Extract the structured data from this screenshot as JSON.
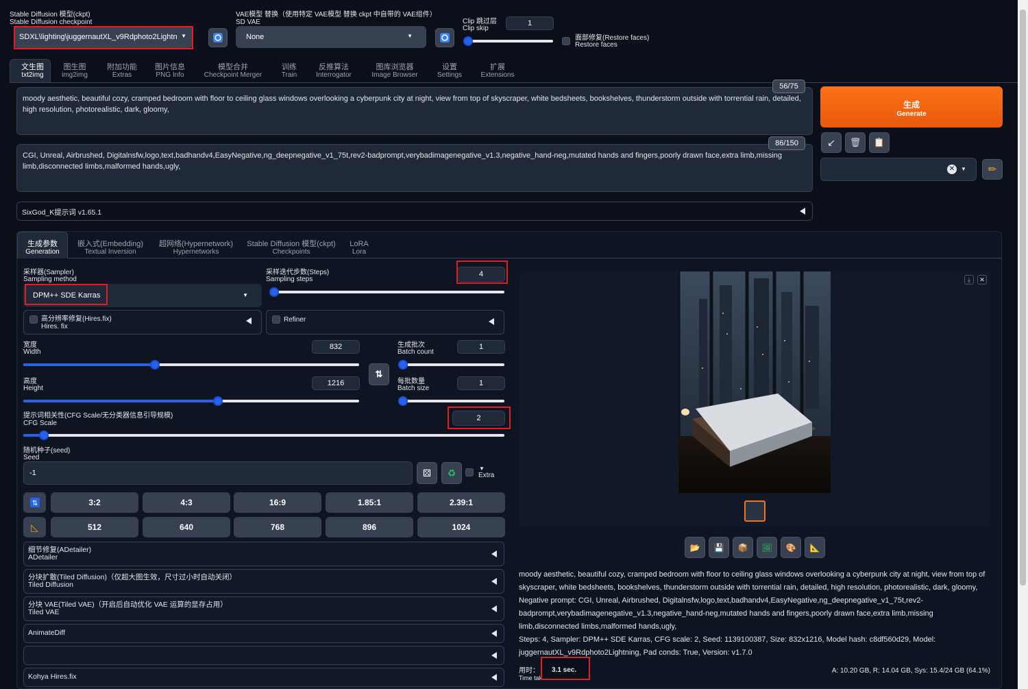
{
  "checkpoint": {
    "label_cn": "Stable Diffusion 模型(ckpt)",
    "label_en": "Stable Diffusion checkpoint",
    "value": "SDXL\\lighting\\juggernautXL_v9Rdphoto2Lightn"
  },
  "vae": {
    "label_cn": "VAE模型 替换（使用特定 VAE模型 替换 ckpt 中自带的 VAE组件）",
    "label_en": "SD VAE",
    "value": "None"
  },
  "clip_skip": {
    "label_cn": "Clip 跳过层",
    "label_en": "Clip skip",
    "value": "1",
    "level": 0.0
  },
  "restore_faces": {
    "label_cn": "面部修复(Restore faces)",
    "label_en": "Restore faces"
  },
  "tabs": [
    {
      "cn": "文生图",
      "en": "txt2img"
    },
    {
      "cn": "图生图",
      "en": "img2img"
    },
    {
      "cn": "附加功能",
      "en": "Extras"
    },
    {
      "cn": "图片信息",
      "en": "PNG Info"
    },
    {
      "cn": "模型合并",
      "en": "Checkpoint Merger"
    },
    {
      "cn": "训练",
      "en": "Train"
    },
    {
      "cn": "反推算法",
      "en": "Interrogator"
    },
    {
      "cn": "图库浏览器",
      "en": "Image Browser"
    },
    {
      "cn": "设置",
      "en": "Settings"
    },
    {
      "cn": "扩展",
      "en": "Extensions"
    }
  ],
  "prompt": {
    "text": "moody aesthetic, beautiful cozy, cramped bedroom with floor to ceiling glass windows overlooking a cyberpunk city at night, view from top of skyscraper, white bedsheets, bookshelves, thunderstorm outside with torrential rain, detailed, high resolution, photorealistic, dark, gloomy,",
    "count": "56/75"
  },
  "negative": {
    "text": "CGI, Unreal, Airbrushed, Digitalnsfw,logo,text,badhandv4,EasyNegative,ng_deepnegative_v1_75t,rev2-badprompt,verybadimagenegative_v1.3,negative_hand-neg,mutated hands and fingers,poorly drawn face,extra limb,missing limb,disconnected limbs,malformed hands,ugly,",
    "count": "86/150"
  },
  "generate": {
    "cn": "生成",
    "en": "Generate"
  },
  "sixgod": "SixGod_K提示词 v1.65.1",
  "subtabs": [
    {
      "cn": "生成参数",
      "en": "Generation"
    },
    {
      "cn": "嵌入式(Embedding)",
      "en": "Textual Inversion"
    },
    {
      "cn": "超网络(Hypernetwork)",
      "en": "Hypernetworks"
    },
    {
      "cn": "Stable Diffusion 模型(ckpt)",
      "en": "Checkpoints"
    },
    {
      "cn": "LoRA",
      "en": "Lora"
    }
  ],
  "sampler": {
    "label_cn": "采样器(Sampler)",
    "label_en": "Sampling method",
    "value": "DPM++ SDE Karras"
  },
  "steps": {
    "label_cn": "采样迭代步数(Steps)",
    "label_en": "Sampling steps",
    "value": "4",
    "level": 0.02
  },
  "hires": {
    "cn": "高分辨率修复(Hires.fix)",
    "en": "Hires. fix"
  },
  "refiner": "Refiner",
  "width": {
    "cn": "宽度",
    "en": "Width",
    "value": "832",
    "level": 0.39
  },
  "height": {
    "cn": "高度",
    "en": "Height",
    "value": "1216",
    "level": 0.58
  },
  "batch_count": {
    "cn": "生成批次",
    "en": "Batch count",
    "value": "1",
    "level": 0.0
  },
  "batch_size": {
    "cn": "每批数量",
    "en": "Batch size",
    "value": "1",
    "level": 0.0
  },
  "cfg": {
    "label_cn": "提示词相关性(CFG Scale/无分类器信息引导规模)",
    "label_en": "CFG Scale",
    "value": "2",
    "level": 0.04
  },
  "seed": {
    "label_cn": "随机种子(seed)",
    "label_en": "Seed",
    "value": "-1",
    "extra": "Extra"
  },
  "aspects": [
    "3:2",
    "4:3",
    "16:9",
    "1.85:1",
    "2.39:1"
  ],
  "sizes": [
    "512",
    "640",
    "768",
    "896",
    "1024"
  ],
  "accordions": [
    {
      "cn": "细节修复(ADetailer)",
      "en": "ADetailer"
    },
    {
      "cn": "分块扩散(Tiled Diffusion)（仅超大图生效，尺寸过小时自动关闭）",
      "en": "Tiled Diffusion"
    },
    {
      "cn": "分块 VAE(Tiled VAE)（开启后自动优化 VAE 运算的显存占用）",
      "en": "Tiled VAE"
    },
    {
      "cn": "AnimateDiff",
      "en": ""
    },
    {
      "cn": "",
      "en": ""
    },
    {
      "cn": "Kohya Hires.fix",
      "en": ""
    }
  ],
  "output": {
    "prompt": "moody aesthetic, beautiful cozy, cramped bedroom with floor to ceiling glass windows overlooking a cyberpunk city at night, view from top of skyscraper, white bedsheets, bookshelves, thunderstorm outside with torrential rain, detailed, high resolution, photorealistic, dark, gloomy,",
    "negative": "Negative prompt: CGI, Unreal, Airbrushed, Digitalnsfw,logo,text,badhandv4,EasyNegative,ng_deepnegative_v1_75t,rev2-badprompt,verybadimagenegative_v1.3,negative_hand-neg,mutated hands and fingers,poorly drawn face,extra limb,missing limb,disconnected limbs,malformed hands,ugly,",
    "params": "Steps: 4, Sampler: DPM++ SDE Karras, CFG scale: 2, Seed: 1139100387, Size: 832x1216, Model hash: c8df560d29, Model: juggernautXL_v9Rdphoto2Lightning, Pad conds: True, Version: v1.7.0",
    "time_cn": "用时：",
    "time_en": "Time taken:",
    "time": "3.1 sec.",
    "vram": "A: 10.20 GB, R: 14.04 GB, Sys: 15.4/24 GB (64.1%)"
  }
}
